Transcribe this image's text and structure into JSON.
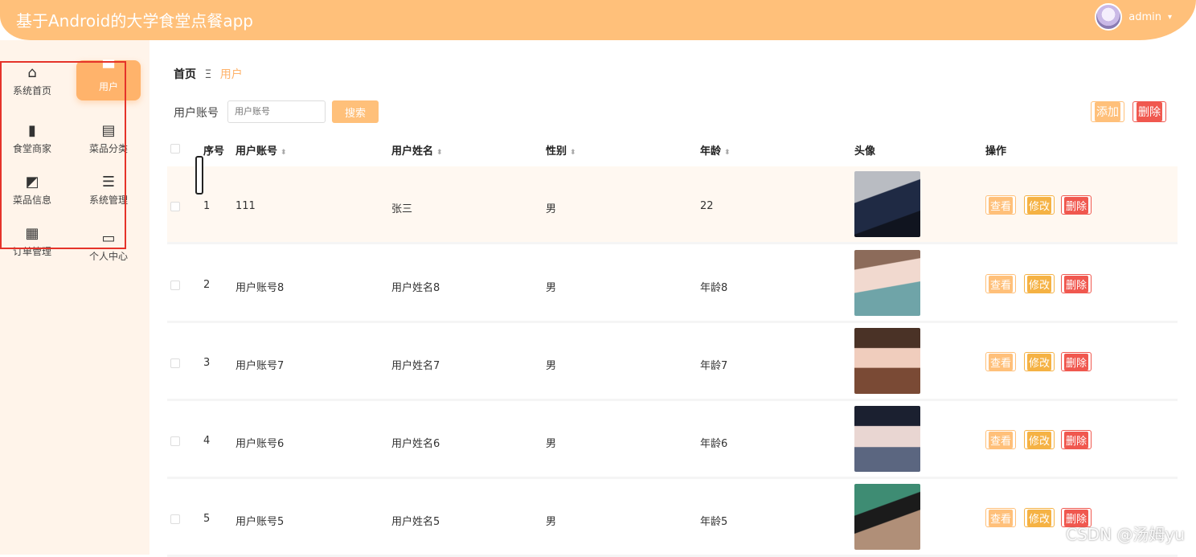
{
  "header": {
    "title": "基于Android的大学食堂点餐app",
    "username": "admin",
    "caret": "▾"
  },
  "sidebar": {
    "items": [
      {
        "label": "系统首页",
        "icon": "home-icon",
        "glyph": "⌂"
      },
      {
        "label": "用户",
        "icon": "user-icon",
        "glyph": "▀"
      },
      {
        "label": "食堂商家",
        "icon": "books-icon",
        "glyph": "▮"
      },
      {
        "label": "菜品分类",
        "icon": "clipboard-icon",
        "glyph": "▤"
      },
      {
        "label": "菜品信息",
        "icon": "chart-icon",
        "glyph": "◩"
      },
      {
        "label": "系统管理",
        "icon": "sliders-icon",
        "glyph": "☰"
      },
      {
        "label": "订单管理",
        "icon": "grid-icon",
        "glyph": "▦"
      },
      {
        "label": "个人中心",
        "icon": "card-icon",
        "glyph": "▭"
      }
    ]
  },
  "breadcrumb": {
    "home": "首页",
    "sep": "Ξ",
    "current": "用户"
  },
  "search": {
    "label": "用户账号",
    "placeholder": "用户账号",
    "button": "搜索"
  },
  "actions": {
    "add": "添加",
    "delete": "删除"
  },
  "table": {
    "headers": {
      "index": "序号",
      "account": "用户账号",
      "name": "用户姓名",
      "gender": "性别",
      "age": "年龄",
      "avatar": "头像",
      "ops": "操作"
    },
    "ops": {
      "view": "查看",
      "edit": "修改",
      "delete": "删除"
    },
    "rows": [
      {
        "index": "1",
        "account": "111",
        "name": "张三",
        "gender": "男",
        "age": "22"
      },
      {
        "index": "2",
        "account": "用户账号8",
        "name": "用户姓名8",
        "gender": "男",
        "age": "年龄8"
      },
      {
        "index": "3",
        "account": "用户账号7",
        "name": "用户姓名7",
        "gender": "男",
        "age": "年龄7"
      },
      {
        "index": "4",
        "account": "用户账号6",
        "name": "用户姓名6",
        "gender": "男",
        "age": "年龄6"
      },
      {
        "index": "5",
        "account": "用户账号5",
        "name": "用户姓名5",
        "gender": "男",
        "age": "年龄5"
      }
    ]
  },
  "watermark": "CSDN @汤姆yu",
  "colors": {
    "header": "#ffc07a",
    "accent": "#ffb36b",
    "danger": "#f0584f",
    "edit": "#f5b244",
    "sidebar_bg": "#fff4ea",
    "highlight_row": "#fff8f1",
    "annotation_frame": "#e5332a"
  }
}
